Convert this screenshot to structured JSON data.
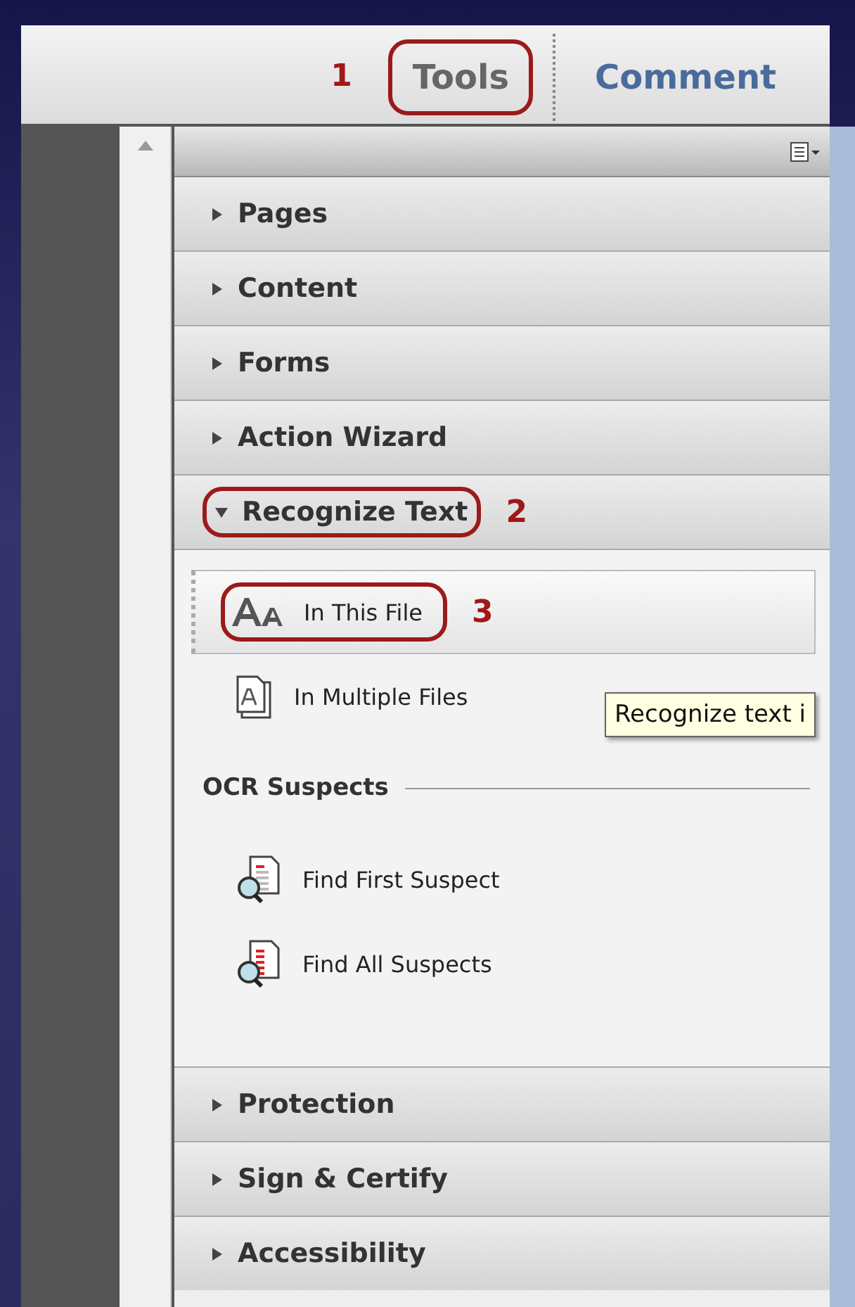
{
  "toolbar": {
    "tabs": [
      {
        "label": "Tools",
        "selected": true,
        "callout": {
          "number": "1",
          "number_first": true
        }
      },
      {
        "label": "Comment",
        "selected": false
      }
    ]
  },
  "panel": {
    "sections": [
      {
        "label": "Pages",
        "expanded": false
      },
      {
        "label": "Content",
        "expanded": false
      },
      {
        "label": "Forms",
        "expanded": false
      },
      {
        "label": "Action Wizard",
        "expanded": false
      },
      {
        "label": "Recognize Text",
        "expanded": true,
        "callout": {
          "number": "2",
          "number_first": false
        },
        "items": [
          {
            "kind": "tool",
            "label": "In This File",
            "selected": true,
            "callout": {
              "number": "3"
            }
          },
          {
            "kind": "tool",
            "label": "In Multiple Files",
            "selected": false
          },
          {
            "kind": "heading",
            "label": "OCR Suspects"
          },
          {
            "kind": "tool",
            "label": "Find First Suspect",
            "selected": false
          },
          {
            "kind": "tool",
            "label": "Find All Suspects",
            "selected": false
          }
        ]
      },
      {
        "label": "Protection",
        "expanded": false
      },
      {
        "label": "Sign & Certify",
        "expanded": false
      },
      {
        "label": "Accessibility",
        "expanded": false
      }
    ]
  },
  "tooltip": {
    "text": "Recognize text i"
  }
}
